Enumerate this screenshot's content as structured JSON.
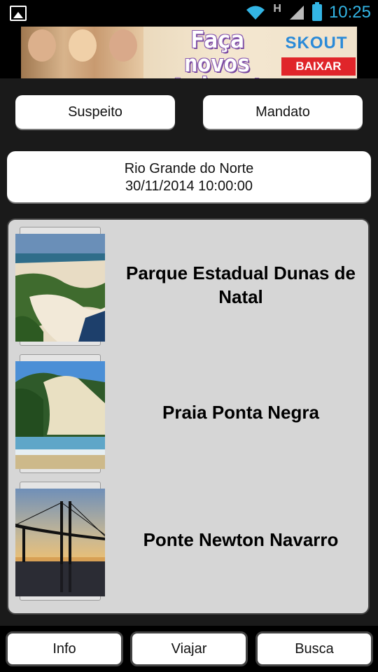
{
  "status_bar": {
    "time": "10:25",
    "network": "H",
    "icons": [
      "gallery-icon",
      "wifi-icon",
      "signal-icon",
      "battery-icon"
    ],
    "accent_color": "#33b5e5"
  },
  "ad": {
    "headline": "Faça novos Amigos!",
    "brand": "SKOUT",
    "cta": "BAIXAR"
  },
  "top_buttons": {
    "suspeito": "Suspeito",
    "mandato": "Mandato"
  },
  "info": {
    "region": "Rio Grande do Norte",
    "datetime": "30/11/2014 10:00:00"
  },
  "places": [
    {
      "name": "Parque Estadual Dunas de Natal",
      "image": "dunes-photo"
    },
    {
      "name": "Praia Ponta Negra",
      "image": "beach-dune-photo"
    },
    {
      "name": "Ponte Newton Navarro",
      "image": "bridge-sunset-photo"
    }
  ],
  "bottom_nav": {
    "info": "Info",
    "viajar": "Viajar",
    "busca": "Busca"
  }
}
